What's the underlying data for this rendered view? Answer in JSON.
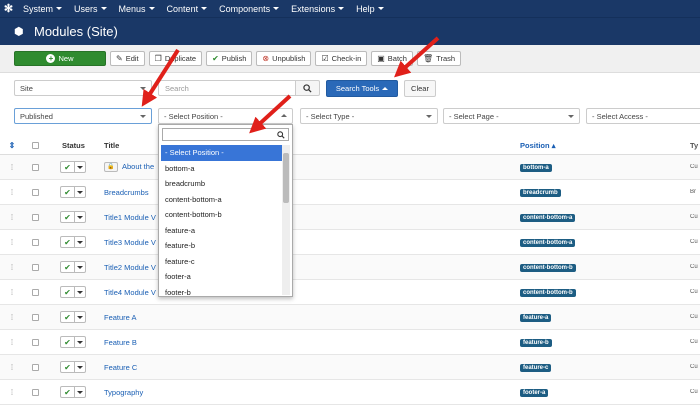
{
  "topmenu": [
    {
      "label": "System"
    },
    {
      "label": "Users"
    },
    {
      "label": "Menus"
    },
    {
      "label": "Content"
    },
    {
      "label": "Components"
    },
    {
      "label": "Extensions"
    },
    {
      "label": "Help"
    }
  ],
  "header": {
    "title": "Modules (Site)"
  },
  "toolbar": {
    "new": "New",
    "edit": "Edit",
    "duplicate": "Duplicate",
    "publish": "Publish",
    "unpublish": "Unpublish",
    "checkin": "Check-in",
    "batch": "Batch",
    "trash": "Trash"
  },
  "filters": {
    "client": "Site",
    "search_placeholder": "Search",
    "search_tools": "Search Tools",
    "clear": "Clear",
    "state": "Published",
    "position": "- Select Position -",
    "type": "- Select Type -",
    "page": "- Select Page -",
    "access": "- Select Access -"
  },
  "position_dropdown": {
    "items": [
      "- Select Position -",
      "bottom-a",
      "breadcrumb",
      "content-bottom-a",
      "content-bottom-b",
      "feature-a",
      "feature-b",
      "feature-c",
      "footer-a",
      "footer-b"
    ]
  },
  "table": {
    "columns": {
      "status": "Status",
      "title": "Title",
      "position": "Position",
      "type": "Ty"
    },
    "rows": [
      {
        "title": "About the",
        "position": "bottom-a",
        "type": "Cu",
        "locked": true
      },
      {
        "title": "Breadcrumbs",
        "position": "breadcrumb",
        "type": "Br"
      },
      {
        "title": "Title1 Module V",
        "position": "content-bottom-a",
        "type": "Cu"
      },
      {
        "title": "Title3 Module V",
        "position": "content-bottom-a",
        "type": "Cu"
      },
      {
        "title": "Title2 Module V",
        "position": "content-bottom-b",
        "type": "Cu"
      },
      {
        "title": "Title4 Module V",
        "position": "content-bottom-b",
        "type": "Cu"
      },
      {
        "title": "Feature A",
        "position": "feature-a",
        "type": "Cu"
      },
      {
        "title": "Feature B",
        "position": "feature-b",
        "type": "Cu"
      },
      {
        "title": "Feature C",
        "position": "feature-c",
        "type": "Cu"
      },
      {
        "title": "Typography",
        "position": "footer-a",
        "type": "Cu"
      }
    ]
  },
  "colors": {
    "navy": "#1a3867",
    "primary": "#2a69b8",
    "success": "#2f8b2f",
    "badge": "#1d5d83",
    "arrow": "#e0201a"
  }
}
